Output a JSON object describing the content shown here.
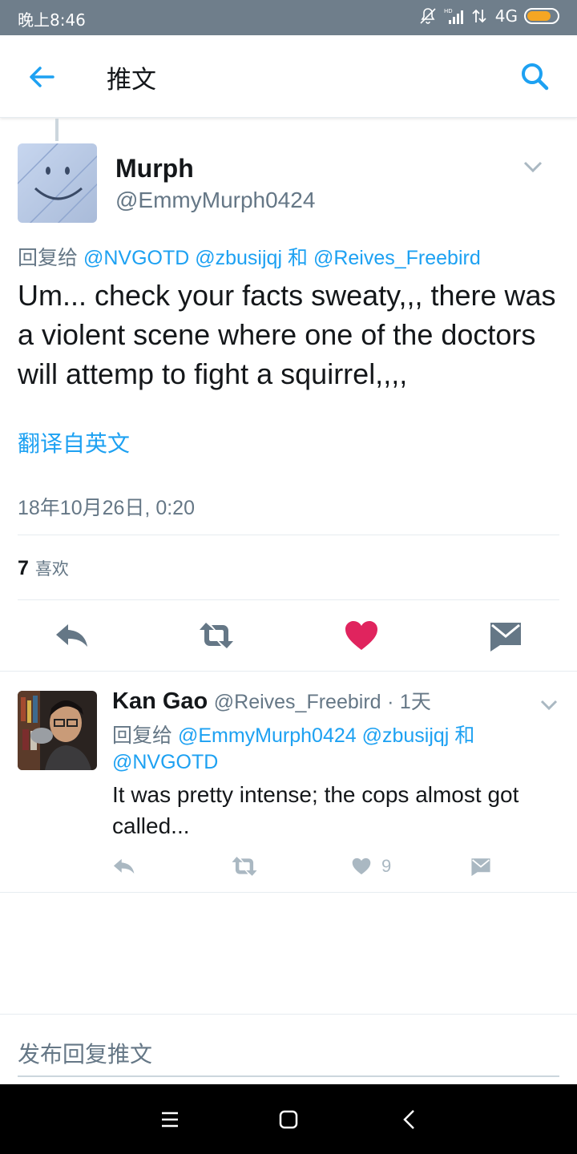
{
  "status_bar": {
    "time": "晚上8:46",
    "network": "4G",
    "battery_level": 0.8,
    "icons": [
      "mute-icon",
      "hd-signal-icon",
      "data-arrows-icon",
      "battery-icon"
    ]
  },
  "header": {
    "title": "推文",
    "back_icon": "arrow-left-icon",
    "search_icon": "search-icon"
  },
  "main_tweet": {
    "display_name": "Murph",
    "handle": "@EmmyMurph0424",
    "reply_prefix": "回复给",
    "reply_mentions": [
      "@NVGOTD",
      "@zbusijqj",
      "@Reives_Freebird"
    ],
    "reply_joiner": "和",
    "text": "Um... check your facts sweaty,,, there was a violent scene where one of the doctors will attemp to fight a squirrel,,,,",
    "translate_label": "翻译自英文",
    "timestamp": "18年10月26日, 0:20",
    "likes_count": "7",
    "likes_label": "喜欢"
  },
  "reply_tweet": {
    "display_name": "Kan Gao",
    "handle": "@Reives_Freebird",
    "separator": "·",
    "time": "1天",
    "reply_prefix": "回复给",
    "reply_mentions": [
      "@EmmyMurph0424",
      "@zbusijqj",
      "@NVGOTD"
    ],
    "reply_joiner": "和",
    "text": "It was pretty intense; the cops almost got called...",
    "like_count": "9"
  },
  "compose": {
    "placeholder": "发布回复推文"
  },
  "colors": {
    "accent": "#1da1f2",
    "like": "#e0245e",
    "secondary_text": "#657786",
    "action_gray": "#657786",
    "status_bar": "#6f7e8b",
    "battery": "#f5a623"
  }
}
